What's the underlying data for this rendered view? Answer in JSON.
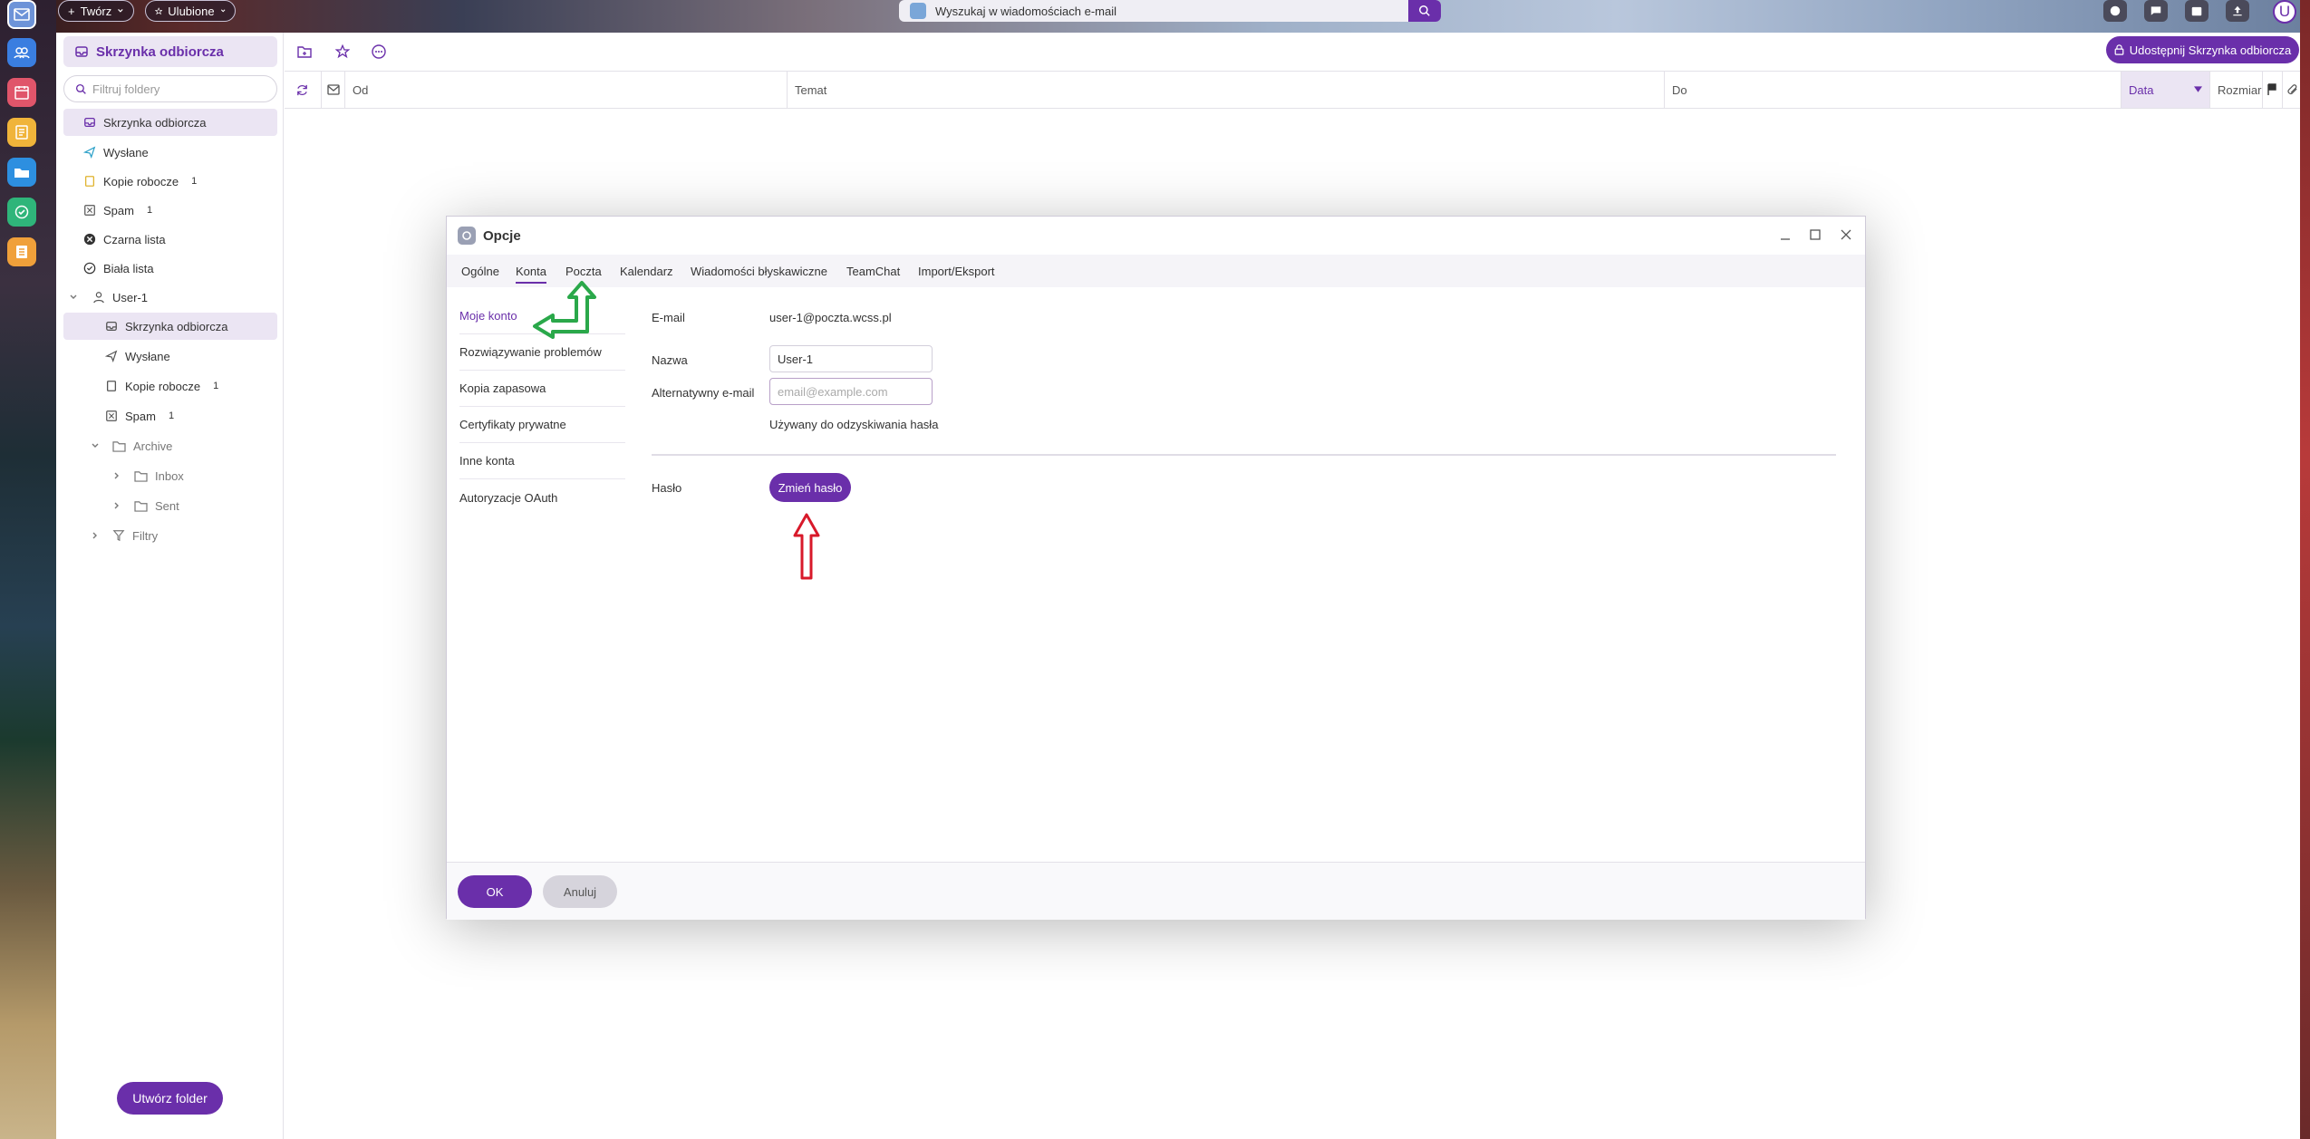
{
  "top_bar": {
    "create_label": "Twórz",
    "favorites_label": "Ulubione",
    "search_placeholder": "Wyszukaj w wiadomościach e-mail",
    "avatar_letter": "U"
  },
  "folder_panel": {
    "header": "Skrzynka odbiorcza",
    "filter_placeholder": "Filtruj foldery",
    "items": [
      {
        "label": "Skrzynka odbiorcza",
        "badge": ""
      },
      {
        "label": "Wysłane",
        "badge": ""
      },
      {
        "label": "Kopie robocze",
        "badge": "1"
      },
      {
        "label": "Spam",
        "badge": "1"
      },
      {
        "label": "Czarna lista",
        "badge": ""
      },
      {
        "label": "Biała lista",
        "badge": ""
      },
      {
        "label": "User-1",
        "badge": ""
      },
      {
        "label": "Skrzynka odbiorcza",
        "badge": ""
      },
      {
        "label": "Wysłane",
        "badge": ""
      },
      {
        "label": "Kopie robocze",
        "badge": "1"
      },
      {
        "label": "Spam",
        "badge": "1"
      },
      {
        "label": "Archive",
        "badge": ""
      },
      {
        "label": "Inbox",
        "badge": ""
      },
      {
        "label": "Sent",
        "badge": ""
      },
      {
        "label": "Filtry",
        "badge": ""
      }
    ],
    "create_folder_label": "Utwórz folder"
  },
  "main": {
    "share_label": "Udostępnij Skrzynka odbiorcza",
    "columns": {
      "from": "Od",
      "subject": "Temat",
      "to": "Do",
      "date": "Data",
      "size": "Rozmiar"
    }
  },
  "dialog": {
    "title": "Opcje",
    "tabs": [
      "Ogólne",
      "Konta",
      "Poczta",
      "Kalendarz",
      "Wiadomości błyskawiczne",
      "TeamChat",
      "Import/Eksport"
    ],
    "nav": [
      "Moje konto",
      "Rozwiązywanie problemów",
      "Kopia zapasowa",
      "Certyfikaty prywatne",
      "Inne konta",
      "Autoryzacje OAuth"
    ],
    "form": {
      "email_label": "E-mail",
      "email_value": "user-1@poczta.wcss.pl",
      "name_label": "Nazwa",
      "name_value": "User-1",
      "alt_email_label": "Alternatywny e-mail",
      "alt_email_placeholder": "email@example.com",
      "alt_email_hint": "Używany do odzyskiwania hasła",
      "password_label": "Hasło",
      "change_password_label": "Zmień hasło"
    },
    "ok_label": "OK",
    "cancel_label": "Anuluj"
  },
  "colors": {
    "accent": "#6a2faa",
    "accent_light": "#ebe5f3",
    "green_arrow": "#2aa84a",
    "red_arrow": "#d8192a"
  }
}
